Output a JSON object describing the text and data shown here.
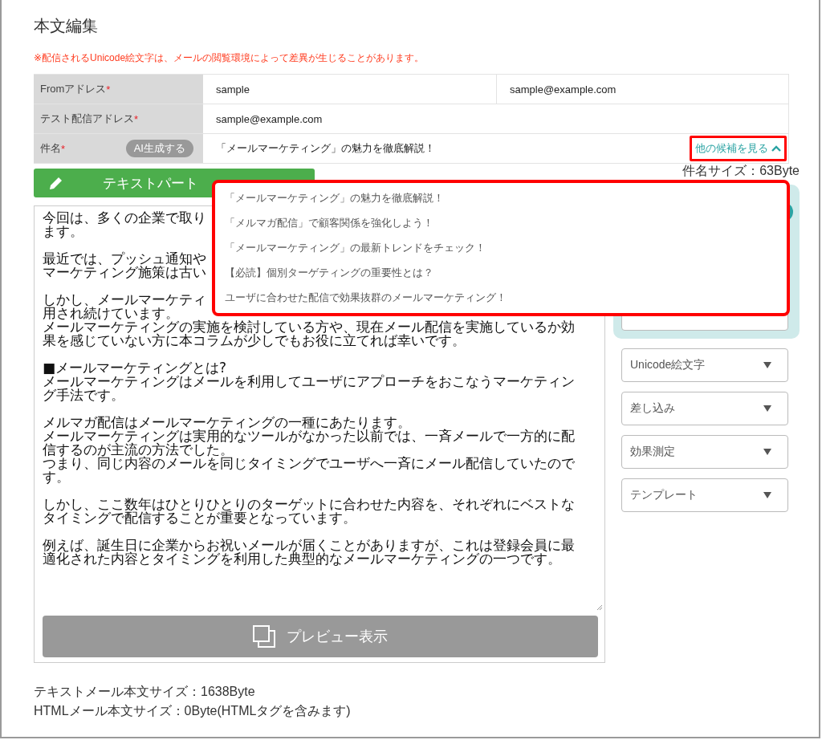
{
  "page_title": "本文編集",
  "notice": "※配信されるUnicode絵文字は、メールの閲覧環境によって差異が生じることがあります。",
  "address_rows": [
    {
      "label": "Fromアドレス",
      "required_mark": "*",
      "values": [
        "sample",
        "sample@example.com"
      ]
    },
    {
      "label": "テスト配信アドレス",
      "required_mark": "*",
      "values": [
        "sample@example.com"
      ]
    }
  ],
  "subject": {
    "label": "件名",
    "required_mark": "*",
    "ai_button": "AI生成する",
    "value": "「メールマーケティング」の魅力を徹底解説！",
    "more_link": {
      "label": "他の候補を見る",
      "expanded": true
    }
  },
  "subject_size": "件名サイズ：63Byte",
  "tabs": [
    {
      "label": "テキストパート",
      "selected": true
    }
  ],
  "body_paragraphs": [
    [
      "今回は、多くの企業で取り",
      "ます。"
    ],
    [
      "最近では、プッシュ通知や",
      "マーケティング施策は古い"
    ],
    [
      "しかし、メールマーケティ",
      "用され続けています。",
      "メールマーケティングの実施を検討している方や、現在メール配信を実施しているか効",
      "果を感じていない方に本コラムが少しでもお役に立てれば幸いです。"
    ],
    [
      "■メールマーケティングとは?",
      "メールマーケティングはメールを利用してユーザにアプローチをおこなうマーケティン",
      "グ手法です。"
    ],
    [
      "メルマガ配信はメールマーケティングの一種にあたります。",
      "メールマーケティングは実用的なツールがなかった以前では、一斉メールで一方的に配",
      "信するのが主流の方法でした。",
      "つまり、同じ内容のメールを同じタイミングでユーザへ一斉にメール配信していたので",
      "す。"
    ],
    [
      "しかし、ここ数年はひとりひとりのターゲットに合わせた内容を、それぞれにベストな",
      "タイミングで配信することが重要となっています。"
    ],
    [
      "例えば、誕生日に企業からお祝いメールが届くことがありますが、これは登録会員に最",
      "適化された内容とタイミングを利用した典型的なメールマーケティングの一つです。"
    ]
  ],
  "preview_button": "プレビュー表示",
  "insert_menus": [
    "Unicode絵文字",
    "差し込み",
    "効果測定",
    "テンプレート"
  ],
  "suggestions": [
    "「メールマーケティング」の魅力を徹底解説！",
    "「メルマガ配信」で顧客関係を強化しよう！",
    "「メールマーケティング」の最新トレンドをチェック！",
    "【必読】個別ターゲティングの重要性とは？",
    "ユーザに合わせた配信で効果抜群のメールマーケティング！"
  ],
  "size_notes": [
    "テキストメール本文サイズ：1638Byte",
    "HTMLメール本文サイズ：0Byte(HTMLタグを含みます)"
  ]
}
